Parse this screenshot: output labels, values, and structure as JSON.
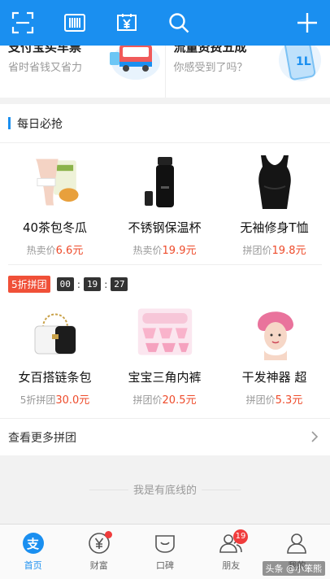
{
  "topbar": {
    "icons": [
      "scan-icon",
      "barcode-icon",
      "yuan-card-icon",
      "search-icon",
      "plus-icon"
    ]
  },
  "promo": {
    "left": {
      "title": "支付宝买车票",
      "subtitle": "省时省钱又省力"
    },
    "right": {
      "title": "流量资费五成",
      "subtitle": "你感受到了吗？"
    }
  },
  "daily": {
    "title": "每日必抢",
    "row1": [
      {
        "name": "40茶包冬瓜",
        "price_label": "热卖价",
        "price": "6.6元",
        "icon": "tea-bag-product"
      },
      {
        "name": "不锈钢保温杯",
        "price_label": "热卖价",
        "price": "19.9元",
        "icon": "thermos-product"
      },
      {
        "name": "无袖修身T恤",
        "price_label": "拼团价",
        "price": "19.8元",
        "icon": "tank-top-product"
      }
    ],
    "flash": {
      "badge": "5折拼团",
      "hh": "00",
      "mm": "19",
      "ss": "27"
    },
    "row2": [
      {
        "name": "女百搭链条包",
        "price_label": "5折拼团",
        "price": "30.0元",
        "icon": "chain-bag-product"
      },
      {
        "name": "宝宝三角内裤",
        "price_label": "拼团价",
        "price": "20.5元",
        "icon": "baby-underwear-product"
      },
      {
        "name": "干发神器  超",
        "price_label": "拼团价",
        "price": "5.3元",
        "icon": "hair-towel-product"
      }
    ],
    "more": "查看更多拼团"
  },
  "footer_note": "我是有底线的",
  "tabs": [
    {
      "label": "首页",
      "icon": "home-zhi-icon",
      "active": true
    },
    {
      "label": "财富",
      "icon": "wealth-icon",
      "dot": true
    },
    {
      "label": "口碑",
      "icon": "koubei-icon"
    },
    {
      "label": "朋友",
      "icon": "friends-icon",
      "count": "19"
    },
    {
      "label": "我的",
      "icon": "me-icon"
    }
  ],
  "watermark": "头条 @小笨熊",
  "colors": {
    "brand": "#1a8ff0",
    "price": "#ee4b2b",
    "badge": "#f05038"
  }
}
